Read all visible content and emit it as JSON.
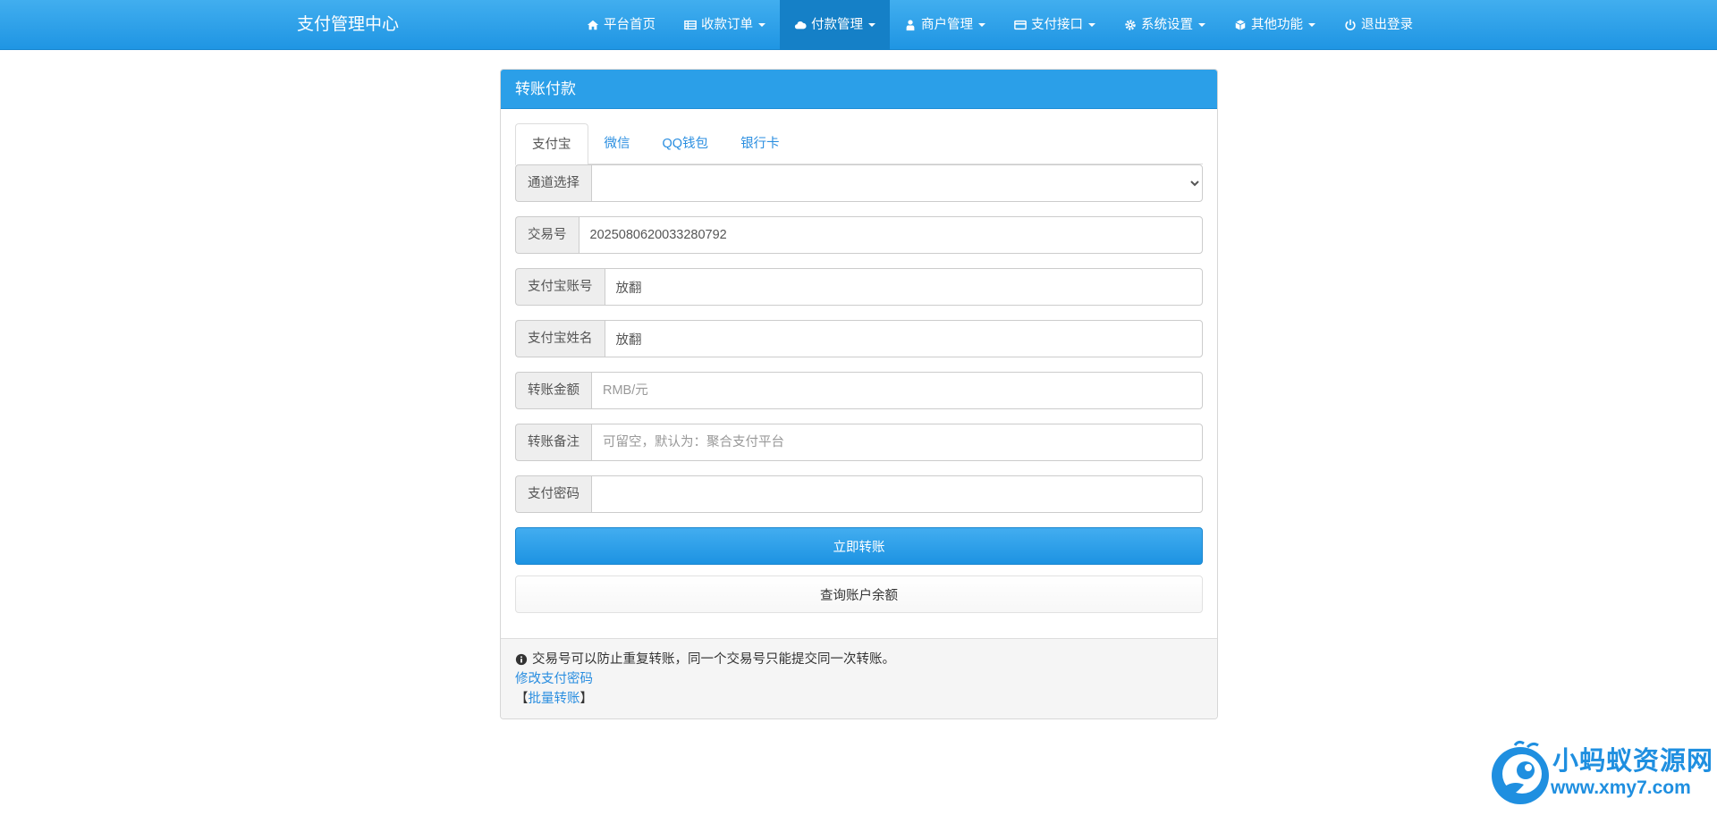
{
  "navbar": {
    "brand": "支付管理中心",
    "items": [
      {
        "label": "平台首页",
        "icon": "home-icon",
        "dropdown": false,
        "active": false
      },
      {
        "label": "收款订单",
        "icon": "list-icon",
        "dropdown": true,
        "active": false
      },
      {
        "label": "付款管理",
        "icon": "cloud-icon",
        "dropdown": true,
        "active": true
      },
      {
        "label": "商户管理",
        "icon": "user-icon",
        "dropdown": true,
        "active": false
      },
      {
        "label": "支付接口",
        "icon": "credit-card-icon",
        "dropdown": true,
        "active": false
      },
      {
        "label": "系统设置",
        "icon": "gear-icon",
        "dropdown": true,
        "active": false
      },
      {
        "label": "其他功能",
        "icon": "cube-icon",
        "dropdown": true,
        "active": false
      },
      {
        "label": "退出登录",
        "icon": "power-icon",
        "dropdown": false,
        "active": false
      }
    ]
  },
  "panel": {
    "title": "转账付款",
    "tabs": [
      {
        "label": "支付宝",
        "active": true
      },
      {
        "label": "微信",
        "active": false
      },
      {
        "label": "QQ钱包",
        "active": false
      },
      {
        "label": "银行卡",
        "active": false
      }
    ],
    "form": {
      "channel": {
        "label": "通道选择",
        "value": ""
      },
      "trade_no": {
        "label": "交易号",
        "value": "2025080620033280792"
      },
      "account": {
        "label": "支付宝账号",
        "value": "放翻"
      },
      "name": {
        "label": "支付宝姓名",
        "value": "放翻"
      },
      "amount": {
        "label": "转账金额",
        "value": "",
        "placeholder": "RMB/元"
      },
      "remark": {
        "label": "转账备注",
        "value": "",
        "placeholder": "可留空，默认为：聚合支付平台"
      },
      "password": {
        "label": "支付密码",
        "value": ""
      }
    },
    "submit_label": "立即转账",
    "balance_label": "查询账户余额",
    "footer": {
      "note": "交易号可以防止重复转账，同一个交易号只能提交同一次转账。",
      "change_password": "修改支付密码",
      "batch_prefix": "【",
      "batch_link": "批量转账",
      "batch_suffix": "】"
    }
  },
  "watermark": {
    "top": "小蚂蚁资源网",
    "bottom": "www.xmy7.com"
  },
  "colors": {
    "primary": "#2b9fe8",
    "link": "#2a8ee0",
    "active_nav": "#1580c7"
  }
}
